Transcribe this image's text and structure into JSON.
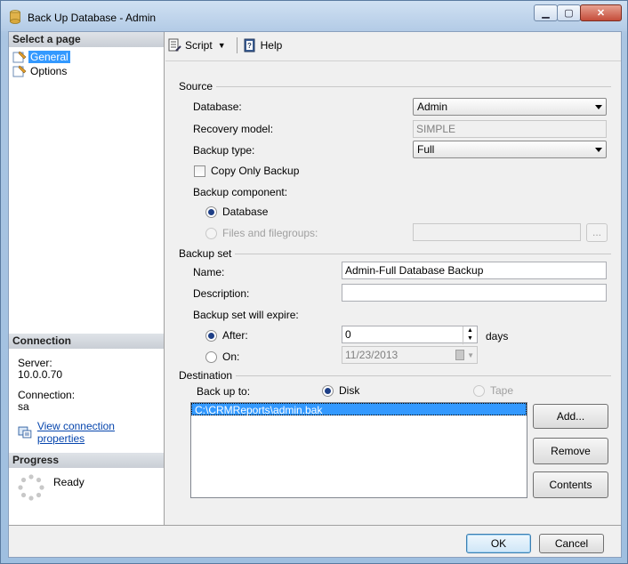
{
  "window": {
    "title": "Back Up Database - Admin"
  },
  "left": {
    "select_page_header": "Select a page",
    "pages": [
      {
        "label": "General",
        "selected": true
      },
      {
        "label": "Options",
        "selected": false
      }
    ],
    "connection_header": "Connection",
    "server_label": "Server:",
    "server_value": "10.0.0.70",
    "connection_label": "Connection:",
    "connection_value": "sa",
    "view_connection_link": "View connection properties",
    "progress_header": "Progress",
    "progress_status": "Ready"
  },
  "toolbar": {
    "script_label": "Script",
    "help_label": "Help"
  },
  "source": {
    "title": "Source",
    "database_label": "Database:",
    "database_value": "Admin",
    "recovery_label": "Recovery model:",
    "recovery_value": "SIMPLE",
    "backup_type_label": "Backup type:",
    "backup_type_value": "Full",
    "copy_only_label": "Copy Only Backup",
    "component_label": "Backup component:",
    "database_radio": "Database",
    "files_radio": "Files and filegroups:",
    "browse_button": "..."
  },
  "backup_set": {
    "title": "Backup set",
    "name_label": "Name:",
    "name_value": "Admin-Full Database Backup",
    "description_label": "Description:",
    "description_value": "",
    "expire_label": "Backup set will expire:",
    "after_label": "After:",
    "after_value": "0",
    "days_label": "days",
    "on_label": "On:",
    "on_value": "11/23/2013"
  },
  "destination": {
    "title": "Destination",
    "backup_to_label": "Back up to:",
    "disk_label": "Disk",
    "tape_label": "Tape",
    "paths": [
      "C:\\CRMReports\\admin.bak"
    ],
    "add_button": "Add...",
    "remove_button": "Remove",
    "contents_button": "Contents"
  },
  "footer": {
    "ok_button": "OK",
    "cancel_button": "Cancel"
  },
  "colors": {
    "selection": "#3399ff",
    "link": "#0645ad",
    "frame": "#b3cbe6"
  }
}
